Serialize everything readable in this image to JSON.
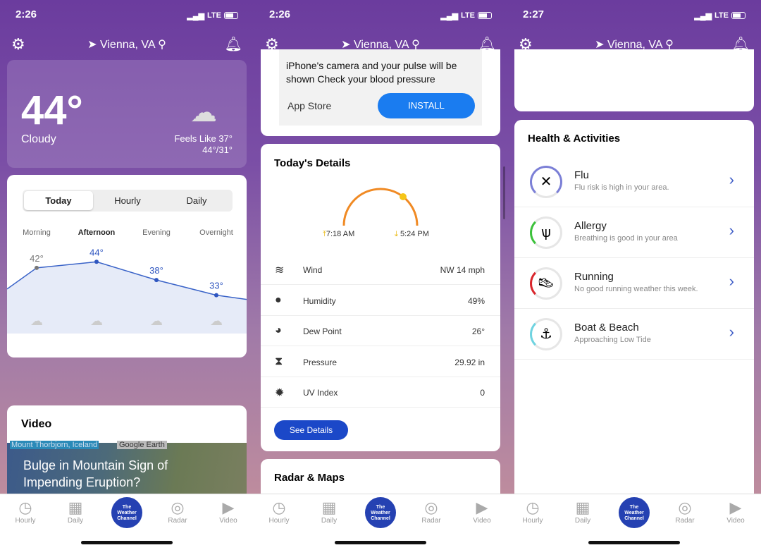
{
  "screens": [
    {
      "time": "2:26",
      "network": "LTE",
      "location": "Vienna, VA"
    },
    {
      "time": "2:26",
      "network": "LTE",
      "location": "Vienna, VA"
    },
    {
      "time": "2:27",
      "network": "LTE",
      "location": "Vienna, VA"
    }
  ],
  "current": {
    "temp": "44°",
    "condition": "Cloudy",
    "feels_like": "Feels Like 37°",
    "hi_lo": "44°/31°"
  },
  "forecast": {
    "tabs": [
      "Today",
      "Hourly",
      "Daily"
    ],
    "selected_tab": "Today",
    "periods": [
      {
        "label": "Morning",
        "temp": "42°",
        "value": 42
      },
      {
        "label": "Afternoon",
        "temp": "44°",
        "value": 44
      },
      {
        "label": "Evening",
        "temp": "38°",
        "value": 38
      },
      {
        "label": "Overnight",
        "temp": "33°",
        "value": 33
      }
    ]
  },
  "video": {
    "title": "Video",
    "location_caption": "Mount Thorbjorn, Iceland",
    "source_caption": "Google Earth",
    "headline": "Bulge in Mountain Sign of Impending Eruption?"
  },
  "ad": {
    "text": "iPhone's camera and your pulse will be shown Check your blood pressure",
    "store": "App Store",
    "install": "INSTALL"
  },
  "details": {
    "title": "Today's Details",
    "sunrise": "7:18 AM",
    "sunset": "5:24 PM",
    "rows": [
      {
        "label": "Wind",
        "value": "NW 14 mph",
        "icon": "wind-icon"
      },
      {
        "label": "Humidity",
        "value": "49%",
        "icon": "droplet-icon"
      },
      {
        "label": "Dew Point",
        "value": "26°",
        "icon": "dew-point-icon"
      },
      {
        "label": "Pressure",
        "value": "29.92 in",
        "icon": "pressure-icon"
      },
      {
        "label": "UV Index",
        "value": "0",
        "icon": "sun-icon"
      }
    ],
    "button": "See Details"
  },
  "radar": {
    "title": "Radar & Maps"
  },
  "health": {
    "title": "Health & Activities",
    "items": [
      {
        "title": "Flu",
        "subtitle": "Flu risk is high in your area.",
        "color": "#7b7fd6"
      },
      {
        "title": "Allergy",
        "subtitle": "Breathing is good in your area",
        "color": "#3cc13b"
      },
      {
        "title": "Running",
        "subtitle": "No good running weather this week.",
        "color": "#d9262c"
      },
      {
        "title": "Boat & Beach",
        "subtitle": "Approaching Low Tide",
        "color": "#6fd3e0"
      }
    ]
  },
  "tabbar": {
    "items": [
      "Hourly",
      "Daily",
      "Radar",
      "Video"
    ],
    "logo": "The Weather Channel"
  }
}
